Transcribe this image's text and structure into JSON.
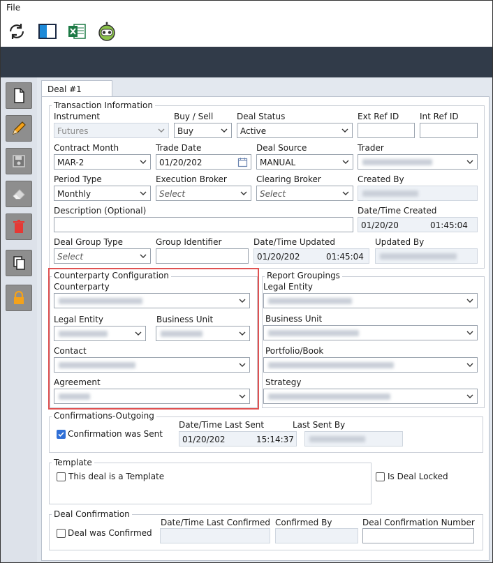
{
  "menu": {
    "file": "File"
  },
  "toolbar": {
    "icons": [
      "refresh-icon",
      "panel-icon",
      "excel-icon",
      "robot-icon"
    ]
  },
  "sidebar": {
    "icons": [
      "new-document-icon",
      "edit-pencil-icon",
      "save-disk-icon",
      "eraser-icon",
      "delete-trash-icon",
      "copy-icon",
      "lock-icon"
    ]
  },
  "tab": {
    "label": "Deal #1"
  },
  "transaction": {
    "title": "Transaction Information",
    "instrument": {
      "label": "Instrument",
      "value": "Futures"
    },
    "buy_sell": {
      "label": "Buy / Sell",
      "value": "Buy"
    },
    "deal_status": {
      "label": "Deal Status",
      "value": "Active"
    },
    "ext_ref": {
      "label": "Ext Ref ID",
      "value": ""
    },
    "int_ref": {
      "label": "Int Ref ID",
      "value": ""
    },
    "contract_month": {
      "label": "Contract Month",
      "value": "MAR-2"
    },
    "trade_date": {
      "label": "Trade Date",
      "value": "01/20/202"
    },
    "deal_source": {
      "label": "Deal Source",
      "value": "MANUAL"
    },
    "trader": {
      "label": "Trader"
    },
    "period_type": {
      "label": "Period Type",
      "value": "Monthly"
    },
    "exec_broker": {
      "label": "Execution Broker",
      "placeholder": "Select"
    },
    "clearing_broker": {
      "label": "Clearing Broker",
      "placeholder": "Select"
    },
    "created_by": {
      "label": "Created By"
    },
    "description": {
      "label": "Description (Optional)",
      "value": ""
    },
    "dt_created": {
      "label": "Date/Time Created",
      "date": "01/20/20",
      "time": "01:45:04"
    },
    "deal_group_type": {
      "label": "Deal Group Type",
      "placeholder": "Select"
    },
    "group_identifier": {
      "label": "Group Identifier",
      "value": ""
    },
    "dt_updated": {
      "label": "Date/Time Updated",
      "date": "01/20/202",
      "time": "01:45:04"
    },
    "updated_by": {
      "label": "Updated By"
    }
  },
  "counterparty": {
    "title": "Counterparty Configuration",
    "counterparty": {
      "label": "Counterparty"
    },
    "legal_entity": {
      "label": "Legal Entity"
    },
    "business_unit": {
      "label": "Business Unit"
    },
    "contact": {
      "label": "Contact"
    },
    "agreement": {
      "label": "Agreement"
    }
  },
  "report": {
    "title": "Report Groupings",
    "legal_entity": {
      "label": "Legal Entity"
    },
    "business_unit": {
      "label": "Business Unit"
    },
    "portfolio": {
      "label": "Portfolio/Book"
    },
    "strategy": {
      "label": "Strategy"
    }
  },
  "confirmations": {
    "title": "Confirmations-Outgoing",
    "sent": {
      "label": "Confirmation was Sent",
      "checked": true
    },
    "dt_last_sent": {
      "label": "Date/Time Last Sent",
      "date": "01/20/202",
      "time": "15:14:37"
    },
    "last_sent_by": {
      "label": "Last Sent By"
    }
  },
  "template": {
    "title": "Template",
    "is_template": {
      "label": "This deal is a Template",
      "checked": false
    },
    "is_locked": {
      "label": "Is Deal Locked",
      "checked": false
    }
  },
  "deal_confirmation": {
    "title": "Deal Confirmation",
    "confirmed": {
      "label": "Deal was Confirmed",
      "checked": false
    },
    "dt_last_confirmed": {
      "label": "Date/Time Last Confirmed"
    },
    "confirmed_by": {
      "label": "Confirmed By"
    },
    "number": {
      "label": "Deal Confirmation Number",
      "value": ""
    }
  },
  "colors": {
    "accent": "#2f6fd6",
    "highlight_box": "#e05252",
    "header_band": "#313b49",
    "sidebar_button": "#8e8e8e"
  }
}
